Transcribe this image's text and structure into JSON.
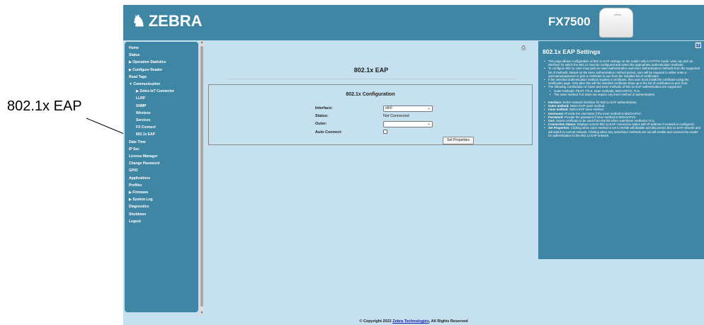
{
  "callout": {
    "label": "802.1x EAP"
  },
  "header": {
    "logo_text": "ZEBRA",
    "model": "FX7500",
    "device_logo": "zebra"
  },
  "sidebar": {
    "items": [
      {
        "label": "Home",
        "level": 0
      },
      {
        "label": "Status",
        "level": 0
      },
      {
        "label": "▶ Operation Statistics",
        "level": 0
      },
      {
        "label": "▶ Configure Reader",
        "level": 0
      },
      {
        "label": "Read Tags",
        "level": 0
      },
      {
        "label": "▼ Communication",
        "level": 0
      },
      {
        "label": "▶ Zebra IoT Connector",
        "level": 1
      },
      {
        "label": "LLRP",
        "level": 1
      },
      {
        "label": "SNMP",
        "level": 1
      },
      {
        "label": "Wireless",
        "level": 1
      },
      {
        "label": "Services",
        "level": 1
      },
      {
        "label": "FX Connect",
        "level": 1
      },
      {
        "label": "802.1x EAP",
        "level": 1
      },
      {
        "label": "Date Time",
        "level": 0
      },
      {
        "label": "IP Sec",
        "level": 0
      },
      {
        "label": "License Manager",
        "level": 0
      },
      {
        "label": "Change Password",
        "level": 0
      },
      {
        "label": "GPIO",
        "level": 0
      },
      {
        "label": "Applications",
        "level": 0
      },
      {
        "label": "Profiles",
        "level": 0
      },
      {
        "label": "▶ Firmware",
        "level": 0
      },
      {
        "label": "▶ System Log",
        "level": 0
      },
      {
        "label": "Diagnostics",
        "level": 0
      },
      {
        "label": "Shutdown",
        "level": 0
      },
      {
        "label": "Logout",
        "level": 0
      }
    ]
  },
  "main": {
    "title": "802.1x EAP",
    "config": {
      "title": "802.1x Configuration",
      "interface_label": "Interface:",
      "interface_value": "eth0",
      "status_label": "Status:",
      "status_value": "Not Connected",
      "outer_label": "Outer:",
      "outer_value": "",
      "auto_connect_label": "Auto Connect:",
      "auto_connect_checked": false,
      "set_button": "Set Properties"
    }
  },
  "help": {
    "badge": "?",
    "title": "802.1x EAP Settings",
    "bullets": [
      "This page allows configuration of 802.1x EAP settings on the reader only in HTTPS mode. User can pick an interface for which the 802.1x must be configured and select the appropriate authentication methods.",
      "To configure 802.1x User must pick an outer authentication and inner authentication methods from the supported list of methods. Based on the inner authentication method picked, user will be required to either enter a username/password or pick a certificate to use from the installed list of certificates.",
      "If the selected authentication method requires a certificate, then user must install the certificate using the certificates page. Only after this will the installed certificate show up in the list of certificates to pick from.",
      "The following combination of Outer and Inner methods of 802.1x EAP authentication are supported:"
    ],
    "sub_bullets": [
      "Outer methods: PEAP, TTLS. Inner methods: MSCHAPV2, TLS.",
      "The outer method TLS does not require any inner method of authentication."
    ],
    "field_help": [
      {
        "term": "Interface:",
        "text": "Select network interface for 802.1x EAP authentication."
      },
      {
        "term": "Outer method:",
        "text": "Select EAP outer method."
      },
      {
        "term": "Inner method:",
        "text": "Select EAP inner method."
      },
      {
        "term": "Username:",
        "text": "Provide the username if the inner method is MSCHAPv2."
      },
      {
        "term": "Password:",
        "text": "Provide the password if inner method is MSCHAPV2."
      },
      {
        "term": "Cert:",
        "text": "Select certificate to be used from the list when outer/inner method is TLS."
      },
      {
        "term": "Connection Status:",
        "text": "Displays current 802.1x EAP connection status with IP address if network is configured."
      },
      {
        "term": "Set Properties:",
        "text": "Clicking when outer method is set to NONE will disable and disconnect 802.1x EAP network and will switch to normal network. Clicking when any outer/inner methods are set will enable and connect the reader for authentication to the 802.1x EAP network."
      }
    ]
  },
  "footer": {
    "prefix": "© Copyright 2022 ",
    "link": "Zebra Technologies",
    "suffix": ", All Rights Reserved"
  }
}
